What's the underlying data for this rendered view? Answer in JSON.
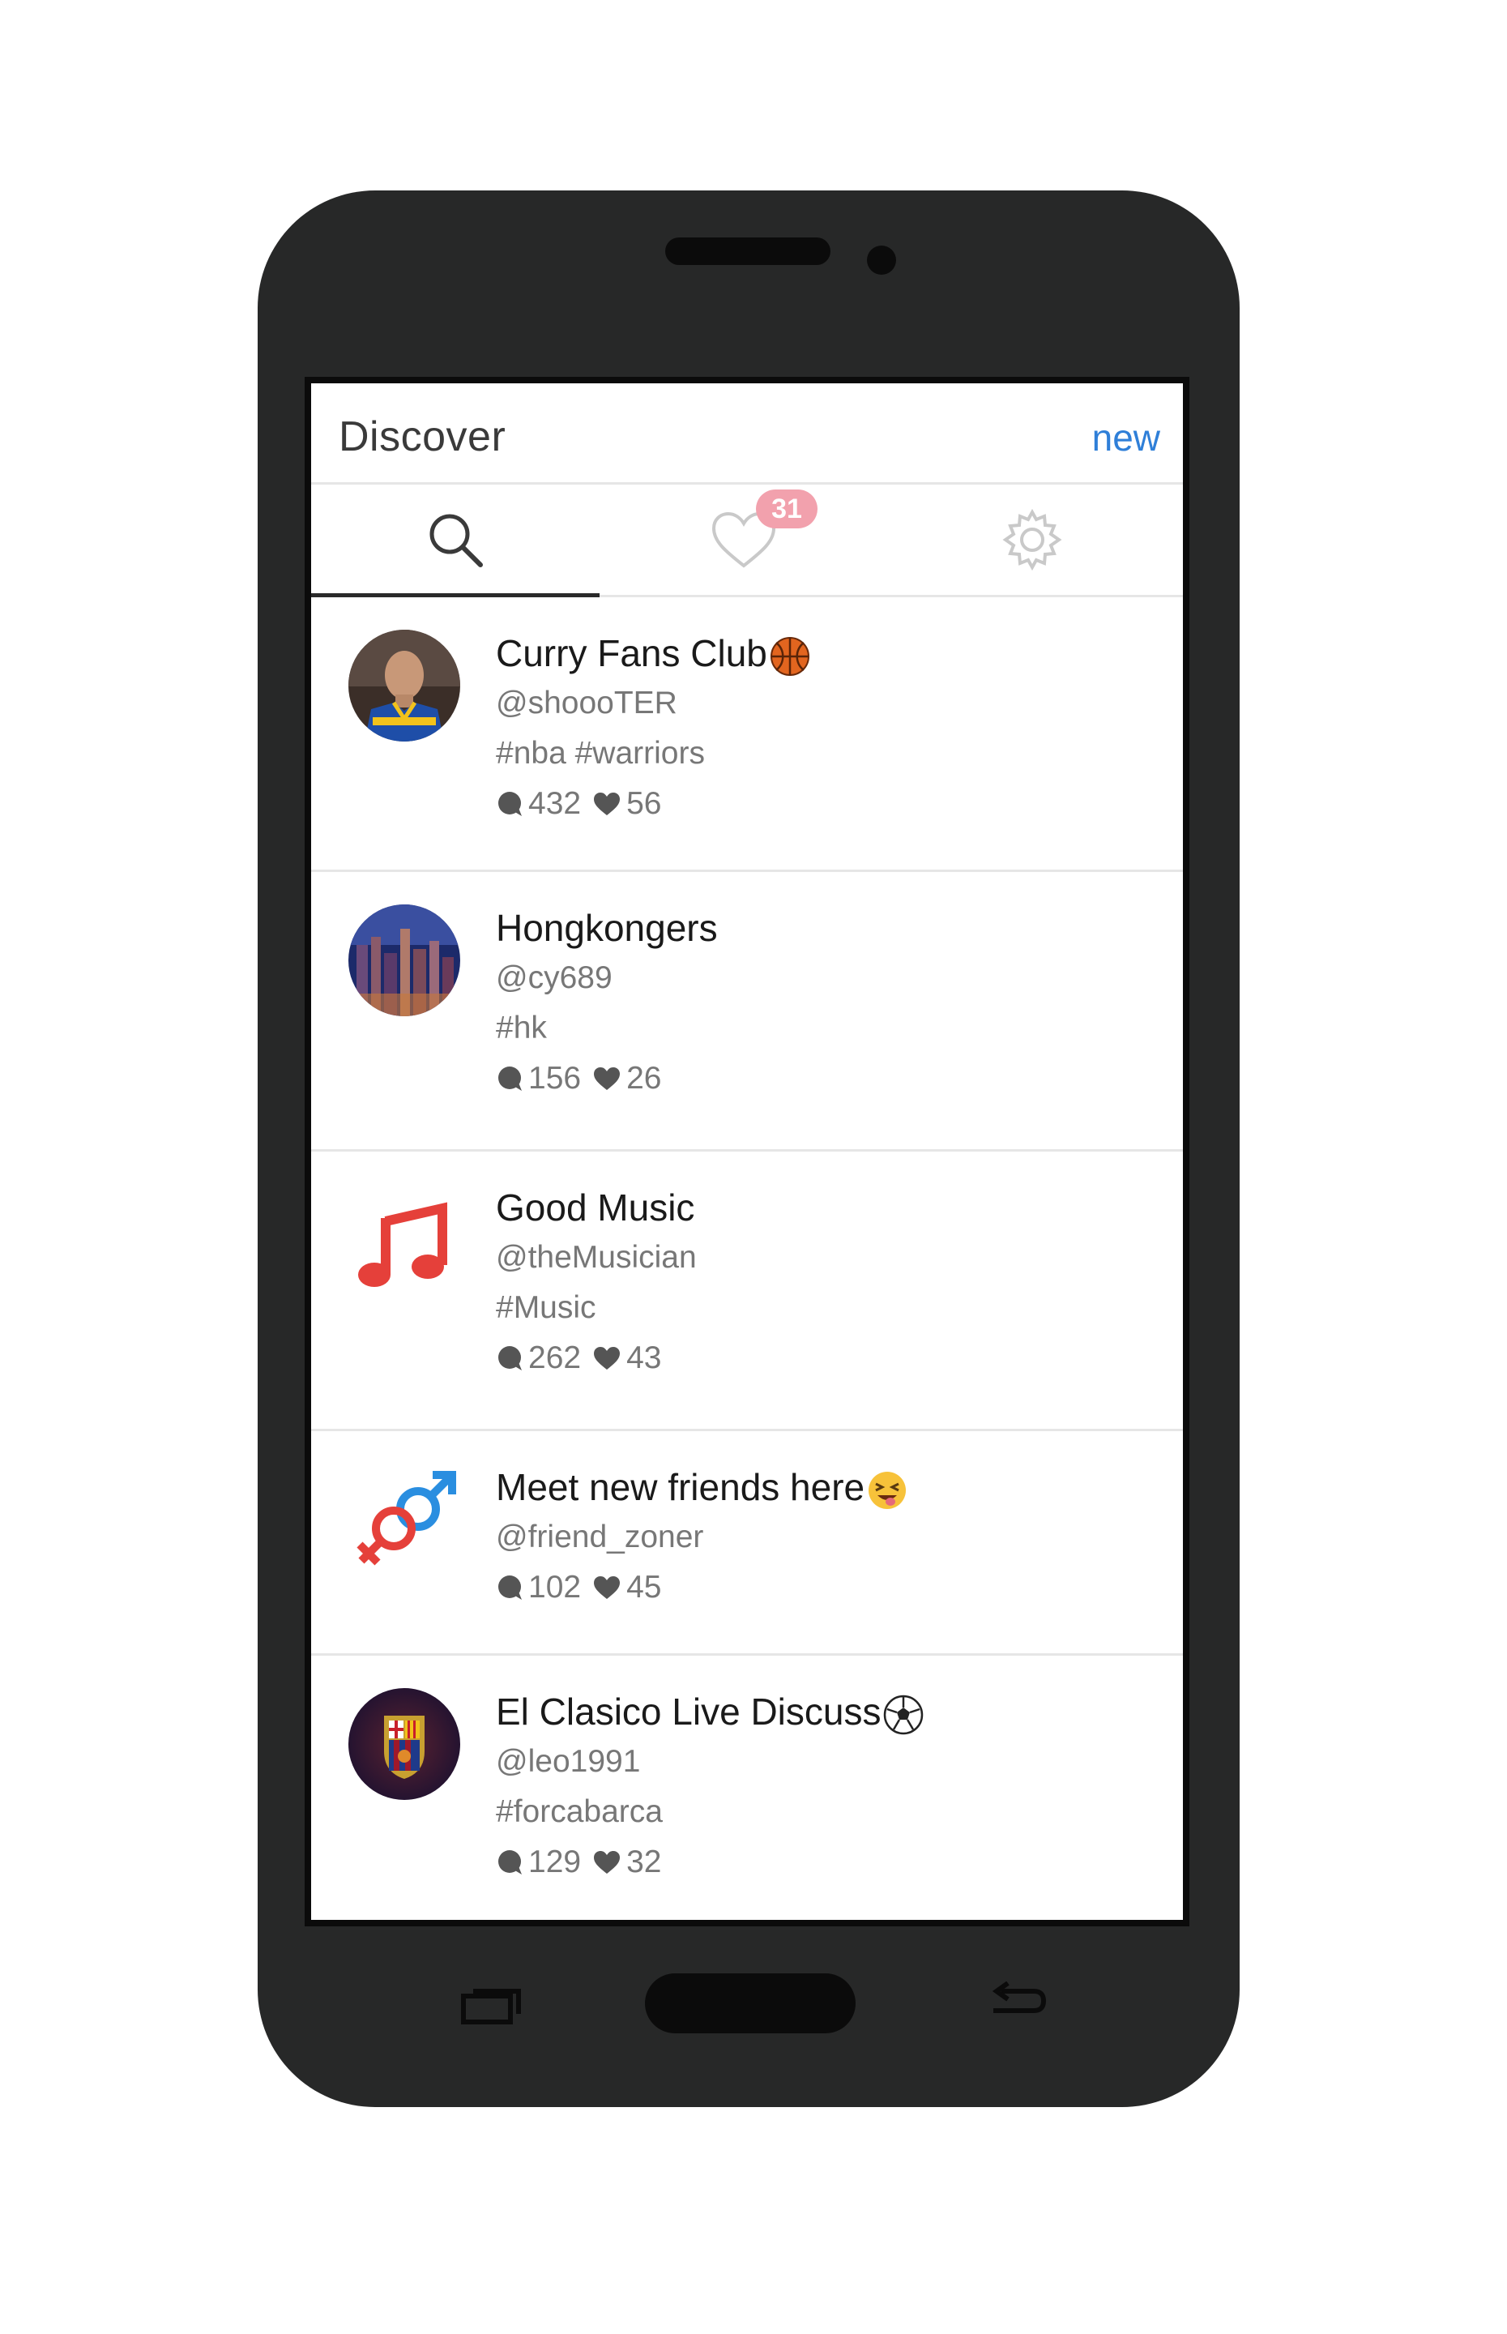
{
  "header": {
    "title": "Discover",
    "new_label": "new"
  },
  "tabs": [
    {
      "icon": "search-icon",
      "active": true
    },
    {
      "icon": "heart-icon",
      "badge": "31",
      "active": false
    },
    {
      "icon": "gear-icon",
      "active": false
    }
  ],
  "groups": [
    {
      "name": "Curry Fans Club",
      "handle": "@shoooTER",
      "tags": "#nba #warriors",
      "comments": "432",
      "likes": "56",
      "avatar": "curry-avatar",
      "emoji": "basketball-icon"
    },
    {
      "name": "Hongkongers",
      "handle": "@cy689",
      "tags": "#hk",
      "comments": "156",
      "likes": "26",
      "avatar": "hongkong-avatar"
    },
    {
      "name": "Good Music",
      "handle": "@theMusician",
      "tags": "#Music",
      "comments": "262",
      "likes": "43",
      "avatar": "music-note-icon"
    },
    {
      "name": "Meet new friends here",
      "handle": "@friend_zoner",
      "comments": "102",
      "likes": "45",
      "avatar": "gender-symbols-icon",
      "emoji": "laughing-face-icon"
    },
    {
      "name": "El Clasico Live Discuss",
      "handle": "@leo1991",
      "tags": "#forcabarca",
      "comments": "129",
      "likes": "32",
      "avatar": "fcb-crest-avatar",
      "emoji": "soccer-ball-icon"
    }
  ],
  "colors": {
    "accent": "#2f7fd8",
    "badge": "#f2a1ad",
    "phone": "#272828",
    "music": "#e5403a"
  }
}
